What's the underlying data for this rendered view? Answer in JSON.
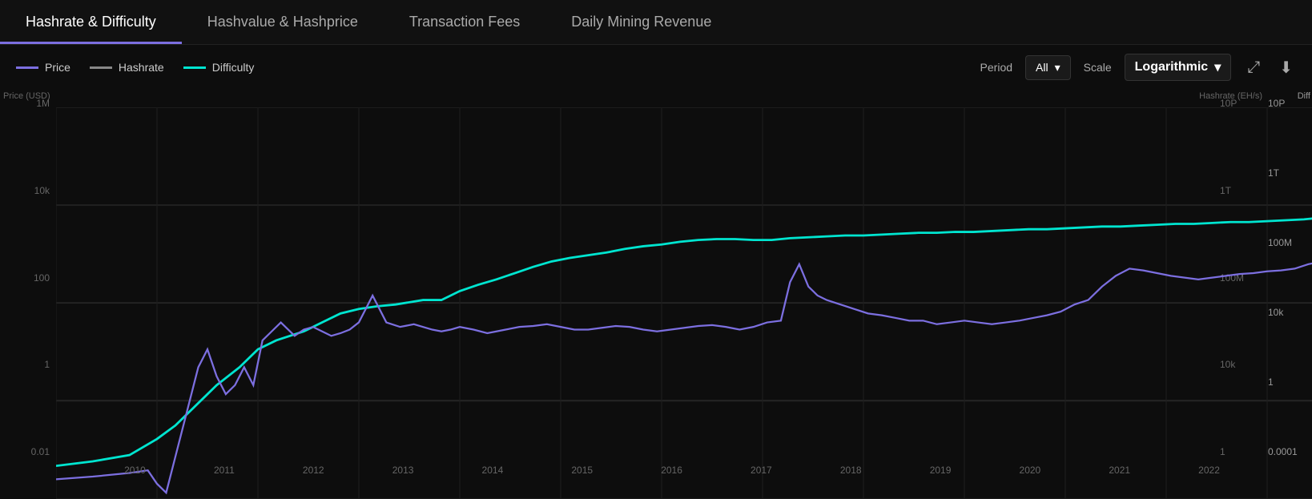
{
  "tabs": [
    {
      "label": "Hashrate & Difficulty",
      "active": true
    },
    {
      "label": "Hashvalue & Hashprice",
      "active": false
    },
    {
      "label": "Transaction Fees",
      "active": false
    },
    {
      "label": "Daily Mining Revenue",
      "active": false
    }
  ],
  "legend": [
    {
      "name": "Price",
      "color": "#7c6fe0",
      "style": "solid"
    },
    {
      "name": "Hashrate",
      "color": "#888",
      "style": "solid"
    },
    {
      "name": "Difficulty",
      "color": "#00e5d0",
      "style": "solid"
    }
  ],
  "controls": {
    "period_label": "Period",
    "period_value": "All",
    "scale_label": "Scale",
    "scale_value": "Logarithmic"
  },
  "chart": {
    "y_axis_left_label": "Price (USD)",
    "y_axis_right_h_label": "Hashrate (EH/s)",
    "y_axis_right_d_label": "Diff",
    "y_left_ticks": [
      "1M",
      "10k",
      "100",
      "1",
      "0.01"
    ],
    "y_right_h_ticks": [
      "10P",
      "1T",
      "100M",
      "10k",
      "1"
    ],
    "y_right_d_ticks": [
      "10P",
      "1T",
      "100M",
      "10k",
      "1",
      "0.0001"
    ],
    "x_ticks": [
      "2010",
      "2011",
      "2012",
      "2013",
      "2014",
      "2015",
      "2016",
      "2017",
      "2018",
      "2019",
      "2020",
      "2021",
      "2022"
    ]
  }
}
